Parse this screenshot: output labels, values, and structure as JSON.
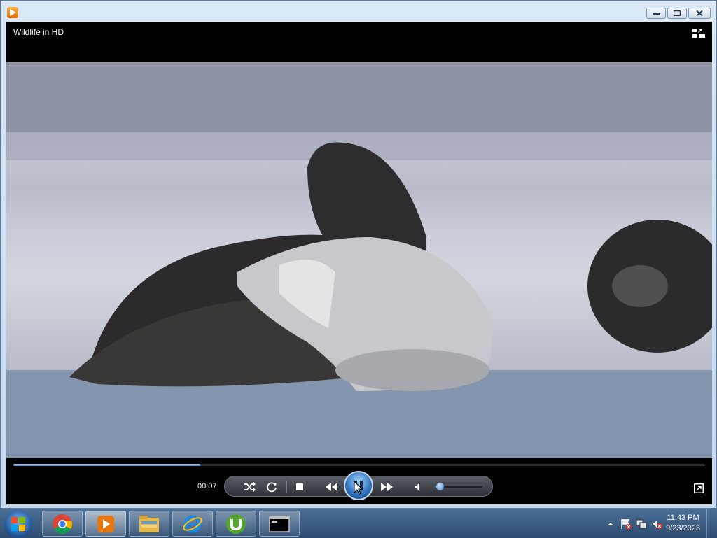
{
  "window": {
    "app_icon": "media-player-icon",
    "buttons": {
      "minimize": "minimize-icon",
      "maximize": "maximize-icon",
      "close": "close-icon"
    }
  },
  "player": {
    "title": "Wildlife in HD",
    "current_time": "00:07",
    "progress_fraction": 0.27,
    "volume_fraction": 0.1,
    "controls": [
      "shuffle-icon",
      "repeat-icon",
      "stop-icon",
      "previous-icon",
      "pause-icon",
      "next-icon",
      "mute-icon",
      "volume-slider",
      "fullscreen-icon",
      "switch-to-library-icon"
    ]
  },
  "taskbar": {
    "items": [
      "start-orb",
      "chrome-icon",
      "media-player-icon",
      "file-explorer-icon",
      "internet-explorer-icon",
      "utorrent-icon",
      "command-prompt-icon"
    ],
    "time": "11:43 PM",
    "date": "9/23/2023"
  },
  "colors": {
    "accent": "#4f86c7",
    "taskbar": "#2c4b70",
    "player_bg": "#000000"
  }
}
